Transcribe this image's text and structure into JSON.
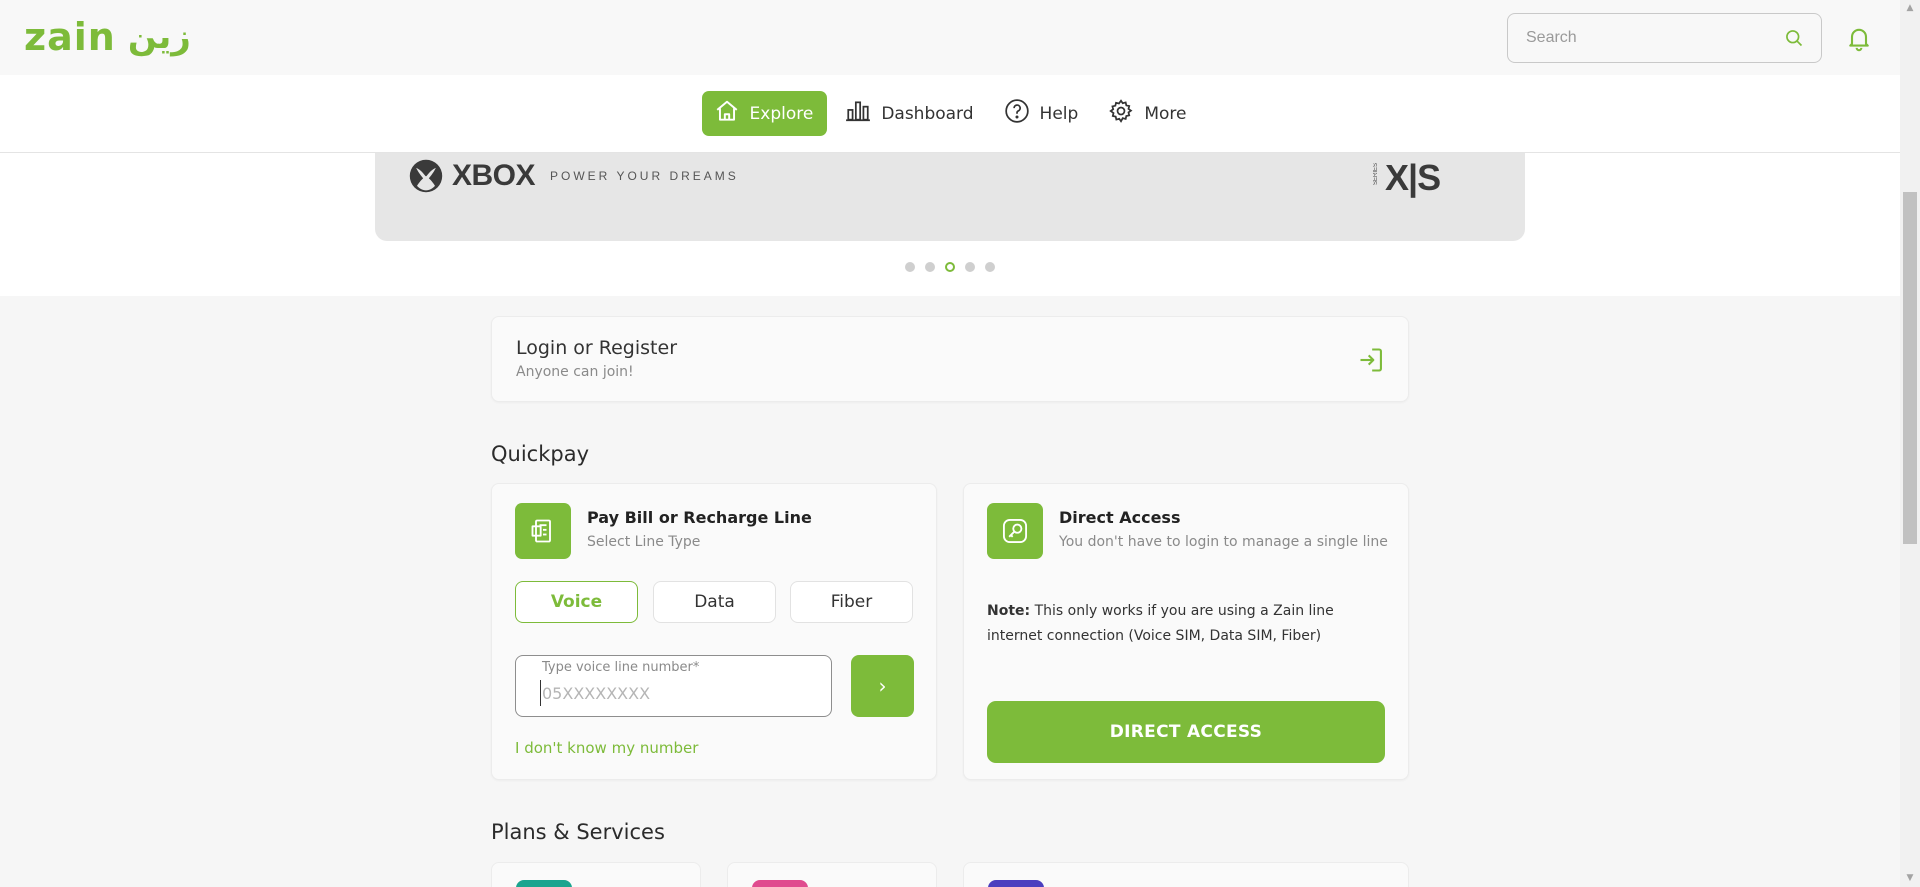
{
  "brand": {
    "name_latin": "zain",
    "name_arabic": "زين",
    "color": "#7dbb3a"
  },
  "header": {
    "search_placeholder": "Search"
  },
  "nav": {
    "items": [
      {
        "label": "Explore",
        "icon": "home-icon",
        "active": true
      },
      {
        "label": "Dashboard",
        "icon": "bar-chart-icon",
        "active": false
      },
      {
        "label": "Help",
        "icon": "question-circle-icon",
        "active": false
      },
      {
        "label": "More",
        "icon": "gear-icon",
        "active": false
      }
    ]
  },
  "banner": {
    "brand_text": "XBOX",
    "tagline": "POWER YOUR DREAMS",
    "series_logo": "X|S",
    "series_small": "SERIES",
    "slide_count": 5,
    "active_slide": 3
  },
  "login": {
    "title": "Login or Register",
    "subtitle": "Anyone can join!"
  },
  "quickpay": {
    "title": "Quickpay",
    "pay_card": {
      "title": "Pay Bill or Recharge Line",
      "subtitle": "Select Line Type",
      "line_types": [
        "Voice",
        "Data",
        "Fiber"
      ],
      "selected_type": "Voice",
      "input_label": "Type voice line number*",
      "input_placeholder": "05XXXXXXXX",
      "input_value": "",
      "submit_symbol": "›",
      "unknown_number_link": "I don't know my number"
    },
    "direct_card": {
      "title": "Direct Access",
      "subtitle": "You don't have to login to manage a single line",
      "note_label": "Note:",
      "note_text": " This only works if you are using a Zain line internet connection (Voice SIM, Data SIM, Fiber)",
      "button_label": "DIRECT ACCESS"
    }
  },
  "plans": {
    "title": "Plans & Services",
    "chip_colors": [
      "#1aa58f",
      "#e04b8f",
      "#4b3fbf"
    ]
  }
}
